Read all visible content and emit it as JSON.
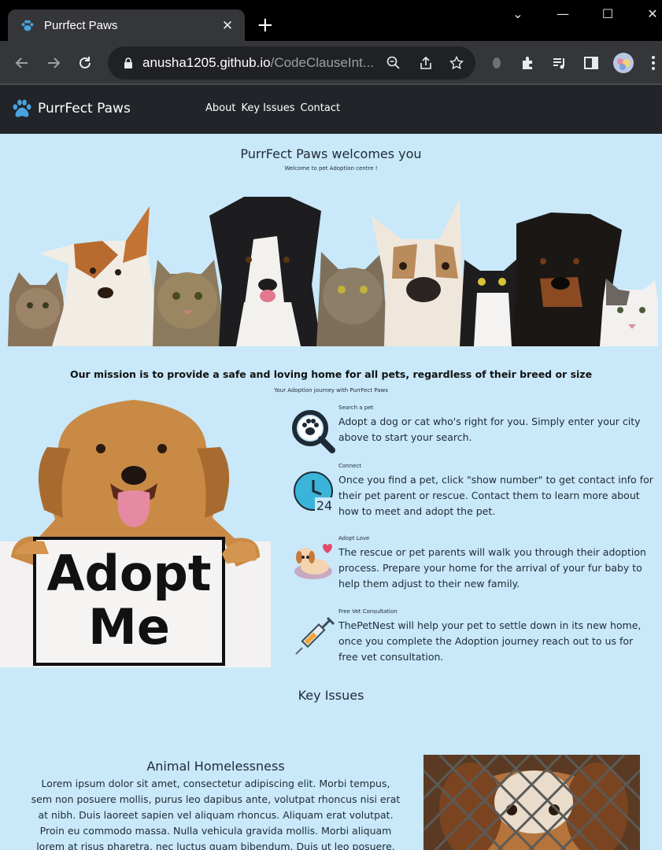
{
  "browser": {
    "tab_title": "Purrfect Paws",
    "new_tab": "+",
    "url_host": "anusha1205.github.io",
    "url_path": "/CodeClauseInt...",
    "window_controls": {
      "minimize": "—",
      "maximize": "☐",
      "close": "✕"
    }
  },
  "nav": {
    "brand": "PurrFect Paws",
    "links": [
      "About",
      "Key Issues",
      "Contact"
    ]
  },
  "welcome": {
    "title": "PurrFect Paws welcomes you",
    "subtitle": "Welcome to pet Adoption centre !"
  },
  "mission": {
    "title": "Our mission is to provide a safe and loving home for all pets, regardless of their breed or size",
    "subtitle": "Your Adoption journey with PurrFect Paws"
  },
  "sign": {
    "line1": "Adopt",
    "line2": "Me"
  },
  "steps": [
    {
      "title": "Search a pet",
      "body": "Adopt a dog or cat who's right for you. Simply enter your city above to start your search.",
      "icon": "paw-search-icon"
    },
    {
      "title": "Connect",
      "body": "Once you find a pet, click \"show number\" to get contact info for their pet parent or rescue. Contact them to learn more about how to meet and adopt the pet.",
      "icon": "clock-24-icon"
    },
    {
      "title": "Adopt Love",
      "body": "The rescue or pet parents will walk you through their adoption process. Prepare your home for the arrival of your fur baby to help them adjust to their new family.",
      "icon": "puppy-love-icon"
    },
    {
      "title": "Free Vet Consultation",
      "body": "ThePetNest will help your pet to settle down in its new home, once you complete the Adoption journey reach out to us for free vet consultation.",
      "icon": "syringe-icon"
    }
  ],
  "key_issues": {
    "heading": "Key Issues",
    "item_title": "Animal Homelessness",
    "item_body": "Lorem ipsum dolor sit amet, consectetur adipiscing elit. Morbi tempus, sem non posuere mollis, purus leo dapibus ante, volutpat rhoncus nisi erat at nibh. Duis laoreet sapien vel aliquam rhoncus. Aliquam erat volutpat. Proin eu commodo massa. Nulla vehicula gravida mollis. Morbi aliquam lorem at risus pharetra, nec luctus quam bibendum. Duis ut leo posuere, scelerisque enim id, venenatis velit."
  },
  "colors": {
    "page_bg": "#c9e8f9",
    "nav_bg": "#212529",
    "brand_accent": "#4aa3df"
  }
}
